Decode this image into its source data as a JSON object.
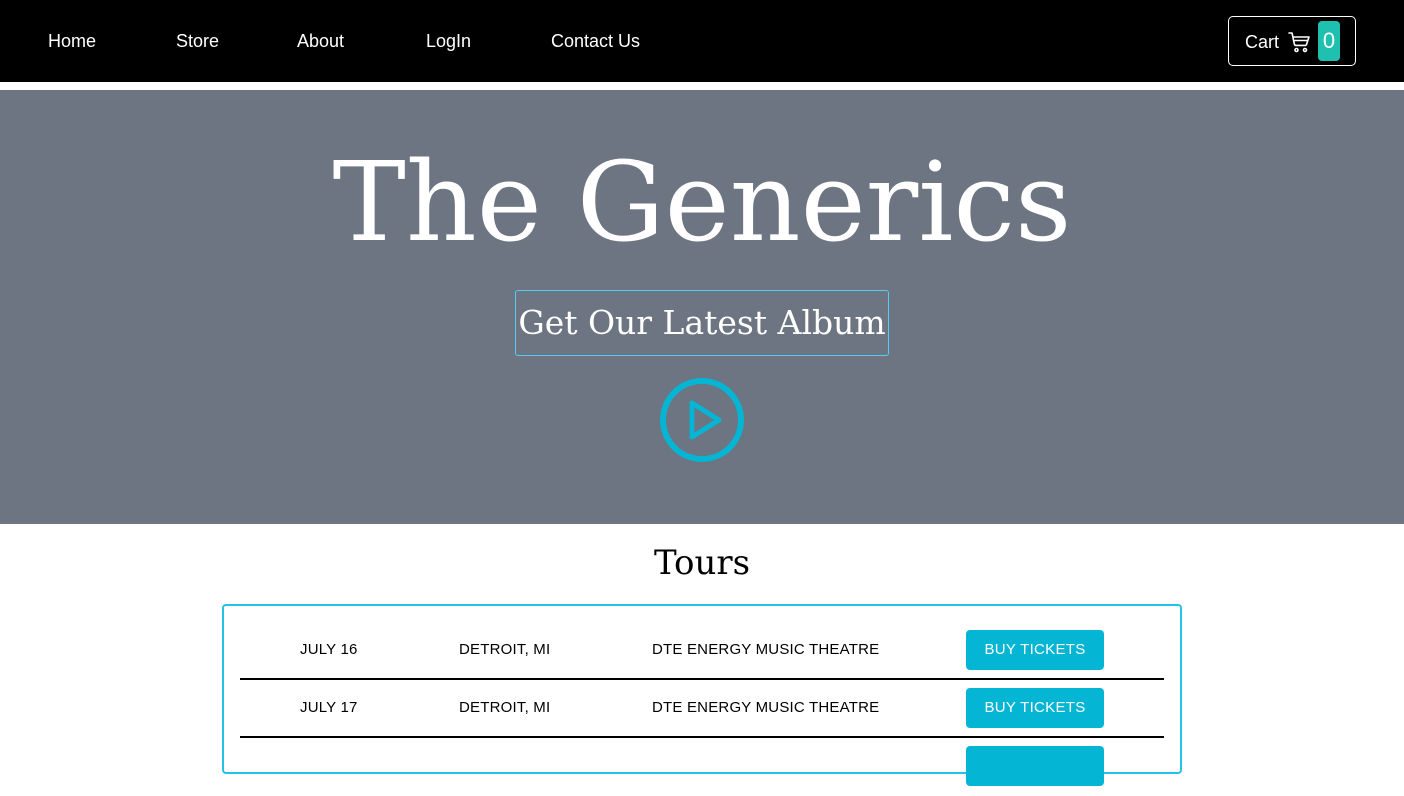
{
  "nav": {
    "links": [
      "Home",
      "Store",
      "About",
      "LogIn",
      "Contact Us"
    ],
    "cart": {
      "label": "Cart",
      "icon": "shopping-cart-icon",
      "count": "0"
    }
  },
  "hero": {
    "title": "The Generics",
    "album_button": "Get Our Latest Album",
    "play_icon": "play-circle-icon"
  },
  "tours": {
    "title": "Tours",
    "rows": [
      {
        "date": "JULY 16",
        "city": "DETROIT, MI",
        "venue": "DTE ENERGY MUSIC THEATRE",
        "button": "BUY TICKETS"
      },
      {
        "date": "JULY 17",
        "city": "DETROIT, MI",
        "venue": "DTE ENERGY MUSIC THEATRE",
        "button": "BUY TICKETS"
      },
      {
        "date": "",
        "city": "",
        "venue": "",
        "button": ""
      }
    ]
  },
  "colors": {
    "nav_bg": "#000000",
    "hero_bg": "#6d7482",
    "accent": "#05b5d4",
    "cart_badge": "#20c0b0"
  }
}
